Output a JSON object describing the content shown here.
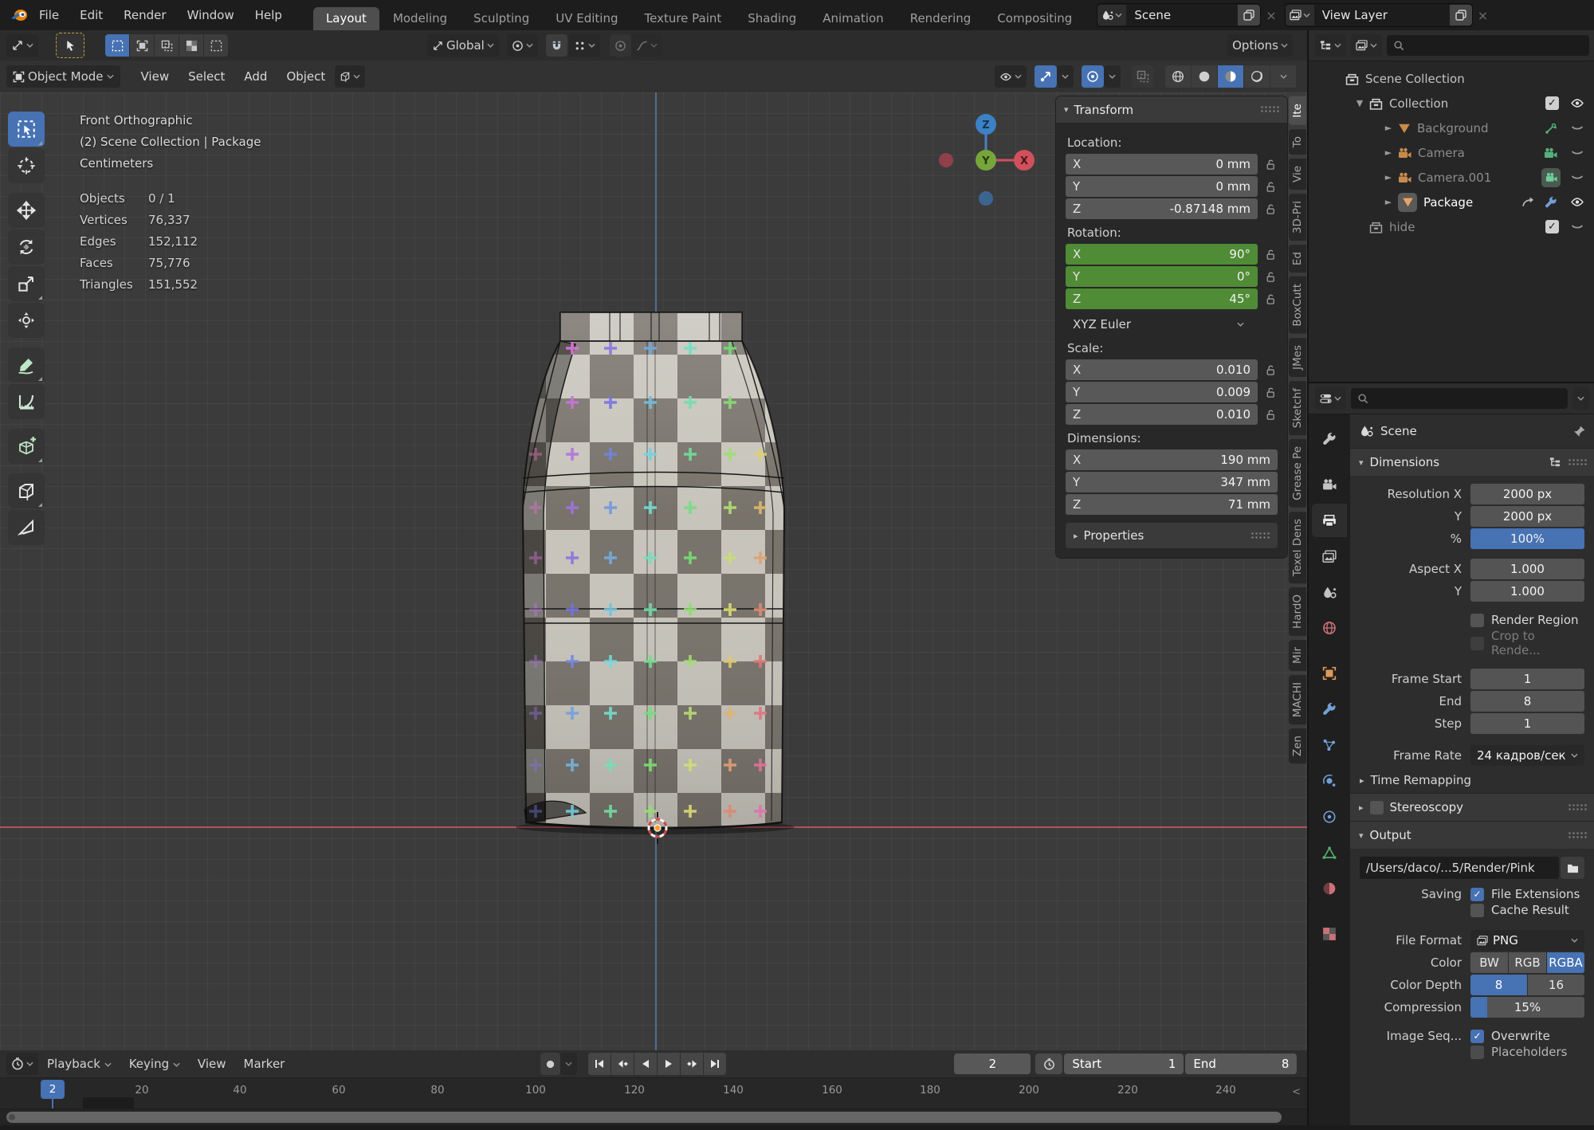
{
  "topbar": {
    "menus": [
      "File",
      "Edit",
      "Render",
      "Window",
      "Help"
    ],
    "tabs": [
      "Layout",
      "Modeling",
      "Sculpting",
      "UV Editing",
      "Texture Paint",
      "Shading",
      "Animation",
      "Rendering",
      "Compositing"
    ],
    "scene_label": "Scene",
    "view_layer_label": "View Layer"
  },
  "tools": {
    "orientation": "Global",
    "options": "Options"
  },
  "vph": {
    "mode": "Object Mode",
    "menus": [
      "View",
      "Select",
      "Add",
      "Object"
    ]
  },
  "viewport": {
    "view": "Front Orthographic",
    "context": "(2) Scene Collection | Package",
    "units": "Centimeters",
    "stats": [
      [
        "Objects",
        "0 / 1"
      ],
      [
        "Vertices",
        "76,337"
      ],
      [
        "Edges",
        "152,112"
      ],
      [
        "Faces",
        "75,776"
      ],
      [
        "Triangles",
        "151,552"
      ]
    ],
    "axis": {
      "x": "X",
      "y": "Y",
      "z": "Z"
    }
  },
  "npanel": {
    "title": "Transform",
    "location_label": "Location:",
    "loc": [
      [
        "X",
        "0 mm"
      ],
      [
        "Y",
        "0 mm"
      ],
      [
        "Z",
        "-0.87148 mm"
      ]
    ],
    "rotation_label": "Rotation:",
    "rot": [
      [
        "X",
        "90°"
      ],
      [
        "Y",
        "0°"
      ],
      [
        "Z",
        "45°"
      ]
    ],
    "euler": "XYZ Euler",
    "scale_label": "Scale:",
    "scale": [
      [
        "X",
        "0.010"
      ],
      [
        "Y",
        "0.009"
      ],
      [
        "Z",
        "0.010"
      ]
    ],
    "dims_label": "Dimensions:",
    "dims": [
      [
        "X",
        "190 mm"
      ],
      [
        "Y",
        "347 mm"
      ],
      [
        "Z",
        "71 mm"
      ]
    ],
    "properties_label": "Properties",
    "tabs": [
      "Ite",
      "To",
      "Vie",
      "3D-Pri",
      "Ed",
      "BoxCutt",
      "JMes",
      "Sketchf",
      "Grease Pe",
      "Texel Dens",
      "HardO",
      "Mir",
      "MACHI",
      "Zen"
    ]
  },
  "outliner": {
    "root": "Scene Collection",
    "collection": "Collection",
    "items": [
      "Background",
      "Camera",
      "Camera.001",
      "Package"
    ],
    "hide": "hide"
  },
  "props": {
    "nav": "Scene",
    "dim_title": "Dimensions",
    "resx": [
      "Resolution X",
      "2000 px"
    ],
    "resy": [
      "Y",
      "2000 px"
    ],
    "pct": [
      "%",
      "100%"
    ],
    "aspx": [
      "Aspect X",
      "1.000"
    ],
    "aspy": [
      "Y",
      "1.000"
    ],
    "render_region": "Render Region",
    "crop": "Crop to Rende...",
    "fstart": [
      "Frame Start",
      "1"
    ],
    "fend": [
      "End",
      "8"
    ],
    "fstep": [
      "Step",
      "1"
    ],
    "frate_label": "Frame Rate",
    "frate": "24 кадров/сек",
    "time_remap": "Time Remapping",
    "stereo": "Stereoscopy",
    "output_title": "Output",
    "path": "/Users/daco/...5/Render/Pink",
    "saving": "Saving",
    "file_ext": "File Extensions",
    "cache": "Cache Result",
    "fformat_label": "File Format",
    "fformat": "PNG",
    "color_label": "Color",
    "bw": "BW",
    "rgb": "RGB",
    "rgba": "RGBA",
    "depth_label": "Color Depth",
    "d8": "8",
    "d16": "16",
    "comp_label": "Compression",
    "comp": "15%",
    "imgseq": "Image Seq...",
    "overwrite": "Overwrite",
    "placeholders": "Placeholders"
  },
  "timeline": {
    "menus": [
      "Playback",
      "Keying",
      "View",
      "Marker"
    ],
    "current": "2",
    "playhead": "2",
    "start_label": "Start",
    "start": "1",
    "end_label": "End",
    "end": "8",
    "ticks": [
      "20",
      "40",
      "60",
      "80",
      "100",
      "120",
      "140",
      "160",
      "180",
      "200",
      "220",
      "240"
    ]
  }
}
